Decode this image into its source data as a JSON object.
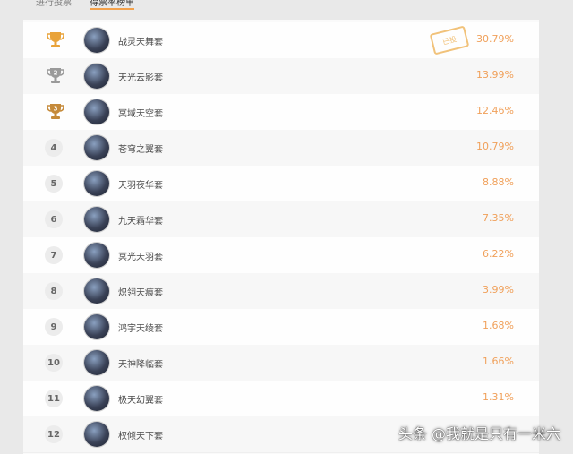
{
  "tabs": {
    "left_label": "进行投票",
    "active_label": "得票率榜单"
  },
  "accent_color": "#f0a05a",
  "rows": [
    {
      "rank": "1",
      "trophy": "gold",
      "name": "战灵天舞套",
      "percent": "30.79%",
      "stamp": "已投"
    },
    {
      "rank": "2",
      "trophy": "silver",
      "name": "天光云影套",
      "percent": "13.99%"
    },
    {
      "rank": "3",
      "trophy": "bronze",
      "name": "冥域天空套",
      "percent": "12.46%"
    },
    {
      "rank": "4",
      "name": "苍穹之翼套",
      "percent": "10.79%"
    },
    {
      "rank": "5",
      "name": "天羽夜华套",
      "percent": "8.88%"
    },
    {
      "rank": "6",
      "name": "九天霜华套",
      "percent": "7.35%"
    },
    {
      "rank": "7",
      "name": "冥光天羽套",
      "percent": "6.22%"
    },
    {
      "rank": "8",
      "name": "炽翎天痕套",
      "percent": "3.99%"
    },
    {
      "rank": "9",
      "name": "鸿宇天绫套",
      "percent": "1.68%"
    },
    {
      "rank": "10",
      "name": "天神降临套",
      "percent": "1.66%"
    },
    {
      "rank": "11",
      "name": "极天幻翼套",
      "percent": "1.31%"
    },
    {
      "rank": "12",
      "name": "权倾天下套",
      "percent": ""
    }
  ],
  "watermark": "头条 @我就是只有一米六"
}
